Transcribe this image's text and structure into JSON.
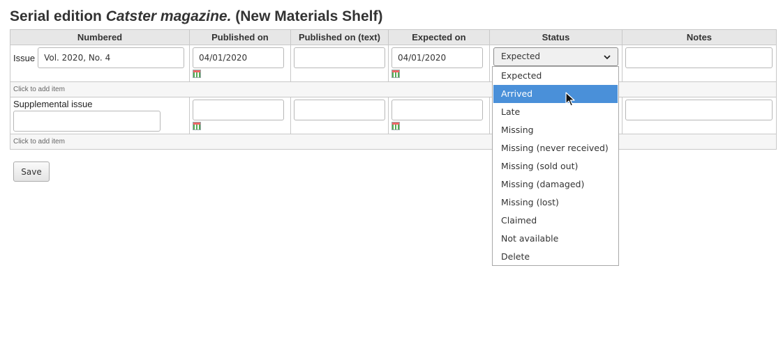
{
  "title": {
    "prefix": "Serial edition ",
    "name": "Catster magazine.",
    "suffix": " (New Materials Shelf)"
  },
  "table": {
    "headers": [
      "Numbered",
      "Published on",
      "Published on (text)",
      "Expected on",
      "Status",
      "Notes"
    ],
    "issue_row": {
      "label": "Issue",
      "numbered_value": "Vol. 2020, No. 4",
      "published_on": "04/01/2020",
      "published_text": "",
      "expected_on": "04/01/2020",
      "notes": ""
    },
    "add_item_label": "Click to add item",
    "supplemental_row": {
      "label": "Supplemental issue",
      "numbered_value": "",
      "published_on": "",
      "published_text": "",
      "expected_on": "",
      "notes": ""
    }
  },
  "status": {
    "selected": "Expected",
    "highlighted": "Arrived",
    "options": [
      "Expected",
      "Arrived",
      "Late",
      "Missing",
      "Missing (never received)",
      "Missing (sold out)",
      "Missing (damaged)",
      "Missing (lost)",
      "Claimed",
      "Not available",
      "Delete"
    ]
  },
  "save_label": "Save",
  "icons": {
    "calendar": "calendar-icon",
    "chevron": "chevron-down-icon",
    "cursor": "mouse-pointer-icon"
  },
  "colors": {
    "highlight": "#4a90d9",
    "header_bg": "#e7e7e7"
  }
}
